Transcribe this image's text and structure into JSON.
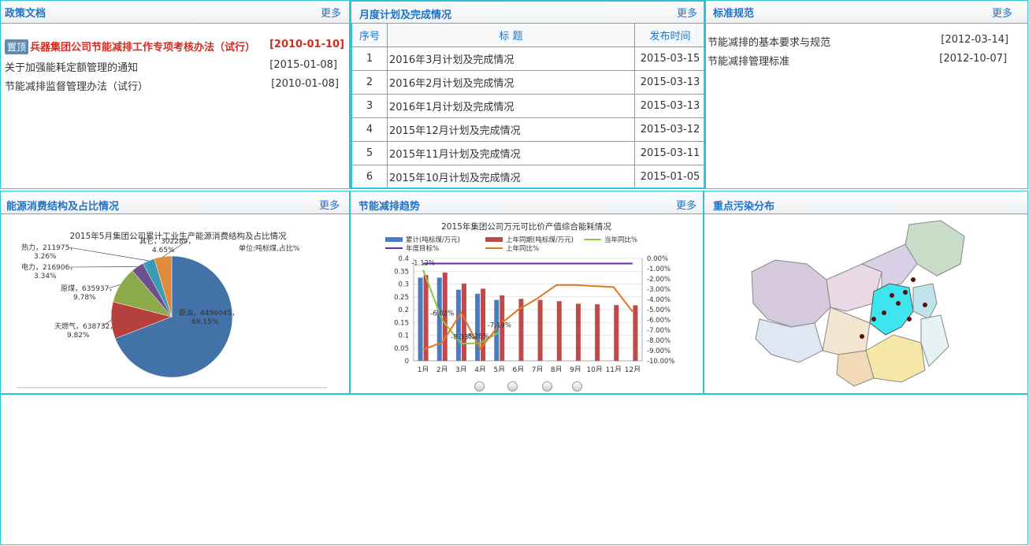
{
  "policy": {
    "title": "政策文档",
    "more": "更多",
    "top_badge": "置顶",
    "items": [
      {
        "title": "兵器集团公司节能减排工作专项考核办法（试行）",
        "date": "[2010-01-10]",
        "pinned": true
      },
      {
        "title": "关于加强能耗定额管理的通知",
        "date": "[2015-01-08]"
      },
      {
        "title": "节能减排监督管理办法（试行）",
        "date": "[2010-01-08]"
      }
    ]
  },
  "monthly": {
    "title": "月度计划及完成情况",
    "more": "更多",
    "headers": [
      "序号",
      "标  题",
      "发布时间"
    ],
    "rows": [
      {
        "no": "1",
        "title": "2016年3月计划及完成情况",
        "date": "2015-03-15"
      },
      {
        "no": "2",
        "title": "2016年2月计划及完成情况",
        "date": "2015-03-13"
      },
      {
        "no": "3",
        "title": "2016年1月计划及完成情况",
        "date": "2015-03-13"
      },
      {
        "no": "4",
        "title": "2015年12月计划及完成情况",
        "date": "2015-03-12"
      },
      {
        "no": "5",
        "title": "2015年11月计划及完成情况",
        "date": "2015-03-11"
      },
      {
        "no": "6",
        "title": "2015年10月计划及完成情况",
        "date": "2015-01-05"
      }
    ]
  },
  "standards": {
    "title": "标准规范",
    "more": "更多",
    "items": [
      {
        "title": "节能减排的基本要求与规范",
        "date": "[2012-03-14]"
      },
      {
        "title": "节能减排管理标准",
        "date": "[2012-10-07]"
      }
    ]
  },
  "energy": {
    "title": "能源消费结构及占比情况",
    "more": "更多"
  },
  "trend": {
    "title": "节能减排趋势",
    "more": "更多"
  },
  "pollution": {
    "title": "重点污染分布"
  },
  "chart_data": [
    {
      "type": "pie",
      "title": "2015年5月集团公司累计工业生产能源消费结构及占比情况",
      "subtitle": "单位:吨标煤,占比%",
      "slices": [
        {
          "name": "原油",
          "value": 4496045,
          "pct": "69.15%",
          "label": "原油，4496045，",
          "color": "#4372a8"
        },
        {
          "name": "天燃气",
          "value": 638732,
          "pct": "9.82%",
          "label": "天燃气，638732，",
          "color": "#b5403d"
        },
        {
          "name": "原煤",
          "value": 635937,
          "pct": "9.78%",
          "label": "原煤，635937，",
          "color": "#8caa4a"
        },
        {
          "name": "电力",
          "value": 216906,
          "pct": "3.34%",
          "label": "电力，216906，",
          "color": "#6c4f8e"
        },
        {
          "name": "热力",
          "value": 211975,
          "pct": "3.26%",
          "label": "热力，211975，",
          "color": "#3c9ab6"
        },
        {
          "name": "其它",
          "value": 302289,
          "pct": "4.65%",
          "label": "其它，302289，",
          "color": "#e08a3c"
        }
      ]
    },
    {
      "type": "bar",
      "title": "2015年集团公司万元可比价产值综合能耗情况",
      "categories": [
        "1月",
        "2月",
        "3月",
        "4月",
        "5月",
        "6月",
        "7月",
        "8月",
        "9月",
        "10月",
        "11月",
        "12月"
      ],
      "ylim": [
        0,
        0.4
      ],
      "yticks": [
        "0",
        "0.05",
        "0.1",
        "0.15",
        "0.2",
        "0.25",
        "0.3",
        "0.35",
        "0.4"
      ],
      "y2lim": [
        -10,
        0
      ],
      "y2ticks": [
        "0.00%",
        "-1.00%",
        "-2.00%",
        "-3.00%",
        "-4.00%",
        "-5.00%",
        "-6.00%",
        "-7.00%",
        "-8.00%",
        "-9.00%",
        "-10.00%"
      ],
      "series": [
        {
          "name": "累计(吨标煤/万元)",
          "kind": "bar",
          "color": "#4a7cc0",
          "values": [
            0.325,
            0.325,
            0.278,
            0.262,
            0.238,
            null,
            null,
            null,
            null,
            null,
            null,
            null
          ]
        },
        {
          "name": "上年同期(吨标煤/万元)",
          "kind": "bar",
          "color": "#c04a4a",
          "values": [
            0.335,
            0.345,
            0.302,
            0.282,
            0.256,
            0.242,
            0.238,
            0.233,
            0.223,
            0.221,
            0.218,
            0.217
          ]
        },
        {
          "name": "当年同比%",
          "kind": "line",
          "axis": "y2",
          "color": "#8dc63f",
          "values": [
            -1.12,
            -6.02,
            -8.33,
            -8.26,
            -7.19,
            null,
            null,
            null,
            null,
            null,
            null,
            null
          ]
        },
        {
          "name": "年度目标%",
          "kind": "line",
          "axis": "y2",
          "color": "#6b2fa0",
          "values": [
            -0.5,
            -0.5,
            -0.5,
            -0.5,
            -0.5,
            -0.5,
            -0.5,
            -0.5,
            -0.5,
            -0.5,
            -0.5,
            -0.5
          ]
        },
        {
          "name": "上年同比%",
          "kind": "line",
          "axis": "y2",
          "color": "#e0781f",
          "values": [
            -8.9,
            -8.2,
            -5.3,
            -8.8,
            -6.5,
            -5.0,
            -3.9,
            -2.6,
            -2.6,
            -2.7,
            -2.8,
            -5.2
          ]
        }
      ],
      "annotations": [
        "-1.12%",
        "-6.02%",
        "-8.33%",
        "-8.26%",
        "-7.19%"
      ]
    }
  ]
}
